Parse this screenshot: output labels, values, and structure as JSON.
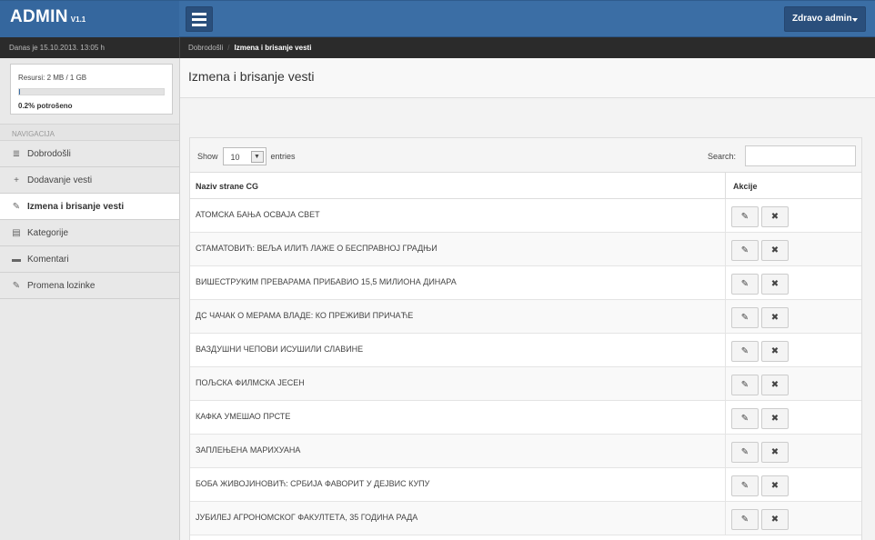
{
  "brand": {
    "name": "ADMIN",
    "version": "V1.1"
  },
  "topbar": {
    "user_label": "Zdravo admin"
  },
  "subbar": {
    "date": "Danas je 15.10.2013. 13:05 h"
  },
  "breadcrumb": {
    "home": "Dobrodošli",
    "current": "Izmena i brisanje vesti"
  },
  "resources": {
    "label": "Resursi: 2 MB / 1 GB",
    "used_label": "0.2% potrošeno",
    "used_fraction": 0.002
  },
  "sidebar": {
    "heading": "NAVIGACIJA",
    "items": [
      {
        "label": "Dobrodošli",
        "icon": "list-icon"
      },
      {
        "label": "Dodavanje vesti",
        "icon": "plus-icon"
      },
      {
        "label": "Izmena i brisanje vesti",
        "icon": "edit-icon",
        "active": true
      },
      {
        "label": "Kategorije",
        "icon": "table-icon"
      },
      {
        "label": "Komentari",
        "icon": "comment-icon"
      },
      {
        "label": "Promena lozinke",
        "icon": "edit-icon"
      }
    ]
  },
  "main": {
    "title": "Izmena i brisanje vesti",
    "table": {
      "show_label": "Show",
      "page_size": "10",
      "entries_label": "entries",
      "search_label": "Search:",
      "columns": [
        "Naziv strane CG",
        "Akcije"
      ],
      "rows": [
        "АТОМСКА БАЊА ОСВАЈА СВЕТ",
        "СТАМАТОВИЋ: ВЕЉА ИЛИЋ ЛАЖЕ О БЕСПРАВНОЈ ГРАДЊИ",
        "ВИШЕСТРУКИМ ПРЕВАРАМА ПРИБАВИО 15,5 МИЛИОНА ДИНАРА",
        "ДС ЧАЧАК О МЕРАМА ВЛАДЕ: КО ПРЕЖИВИ ПРИЧАЋЕ",
        "ВАЗДУШНИ ЧЕПОВИ ИСУШИЛИ СЛАВИНЕ",
        "ПОЉСКА ФИЛМСКА ЈЕСЕН",
        "КАФКА УМЕШАО ПРСТЕ",
        "ЗАПЛЕЊЕНА МАРИХУАНА",
        "БОБА ЖИВОЈИНОВИЋ: СРБИЈА ФАВОРИТ У ДЕЈВИС КУПУ",
        "ЈУБИЛЕЈ АГРОНОМСКОГ ФАКУЛТЕТА, 35 ГОДИНА РАДА"
      ]
    }
  },
  "colors": {
    "accent": "#3b6ea5",
    "dark_bar": "#2b2b2b"
  }
}
